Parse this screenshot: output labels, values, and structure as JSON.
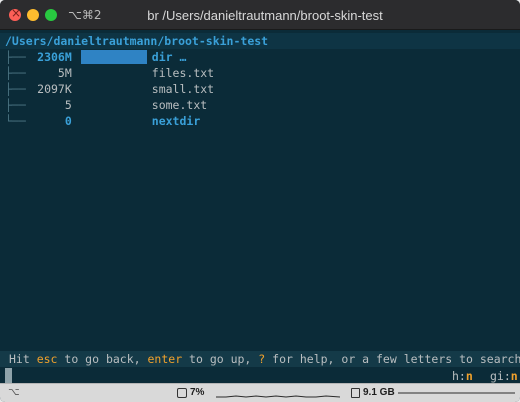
{
  "window": {
    "shortcut": "⌥⌘2",
    "title": "br /Users/danieltrautmann/broot-skin-test"
  },
  "tree": {
    "root": "/Users/danieltrautmann/broot-skin-test",
    "rows": [
      {
        "branch": "├──",
        "size": "2306M",
        "fraction": 1.0,
        "name": "dir …",
        "is_dir": true,
        "selected": true
      },
      {
        "branch": "├──",
        "size": "5M",
        "fraction": 0.0,
        "name": "files.txt",
        "is_dir": false,
        "selected": false
      },
      {
        "branch": "├──",
        "size": "2097K",
        "fraction": 0.0,
        "name": "small.txt",
        "is_dir": false,
        "selected": false
      },
      {
        "branch": "├──",
        "size": "5",
        "fraction": 0.0,
        "name": "some.txt",
        "is_dir": false,
        "selected": false
      },
      {
        "branch": "└──",
        "size": "0",
        "fraction": 0.0,
        "name": "nextdir",
        "is_dir": true,
        "selected": false
      }
    ]
  },
  "status": {
    "p1": "Hit ",
    "k1": "esc",
    "p2": " to go back, ",
    "k2": "enter",
    "p3": " to go up, ",
    "k3": "?",
    "p4": " for help, or a few letters to search"
  },
  "flags": {
    "h_label": "h:",
    "h_value": "n",
    "gi_label": "gi:",
    "gi_value": "n"
  },
  "bottom": {
    "left_glyph": "⌥",
    "cpu": "7%",
    "memory": "9.1 GB"
  },
  "colors": {
    "background": "#0b2b38",
    "directory": "#3aa0d8",
    "key_highlight": "#f0a12c",
    "size_bar": "#2f83c4"
  }
}
